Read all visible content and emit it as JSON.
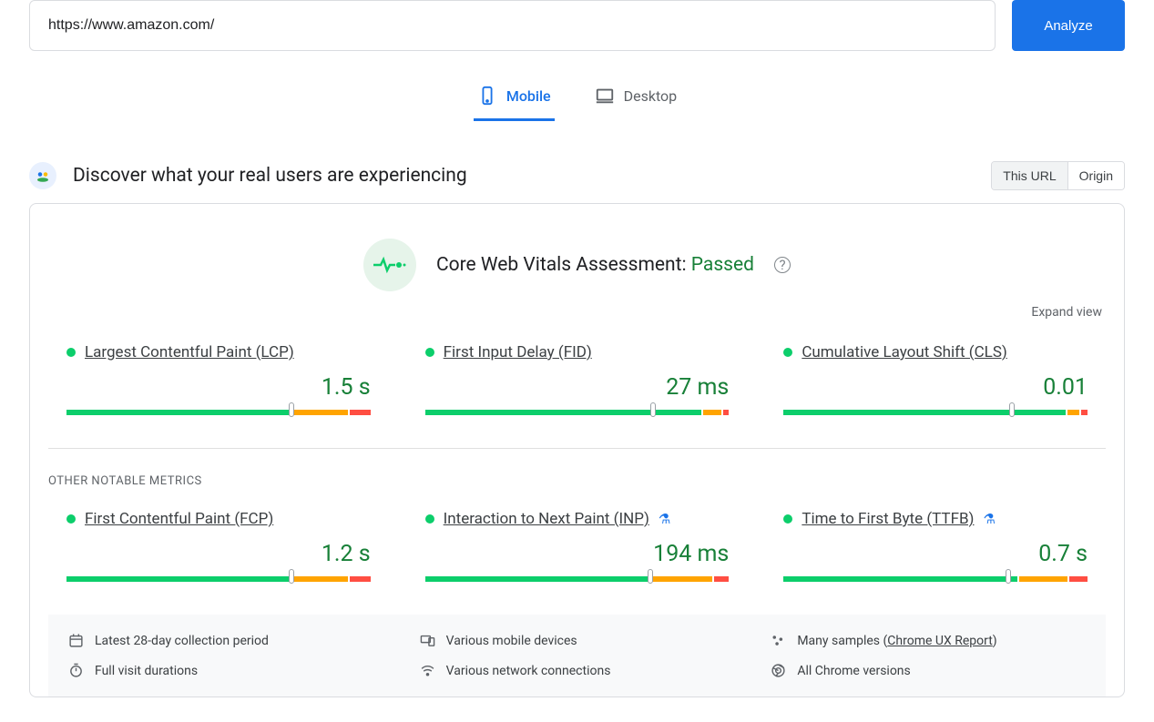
{
  "input": {
    "url": "https://www.amazon.com/",
    "button_label": "Analyze"
  },
  "tabs": {
    "mobile": "Mobile",
    "desktop": "Desktop",
    "active": "mobile"
  },
  "discover": {
    "title": "Discover what your real users are experiencing"
  },
  "scope_toggle": {
    "this_url": "This URL",
    "origin": "Origin",
    "active": "this_url"
  },
  "assessment": {
    "label": "Core Web Vitals Assessment: ",
    "status": "Passed"
  },
  "expand_label": "Expand view",
  "section_label": "OTHER NOTABLE METRICS",
  "metrics": {
    "lcp": {
      "name": "Largest Contentful Paint (LCP)",
      "value": "1.5 s",
      "status": "good",
      "experimental": false,
      "bar": {
        "green": 75,
        "orange": 18,
        "red": 7
      },
      "marker": 74
    },
    "fid": {
      "name": "First Input Delay (FID)",
      "value": "27 ms",
      "status": "good",
      "experimental": false,
      "bar": {
        "green": 92,
        "orange": 6,
        "red": 2
      },
      "marker": 75
    },
    "cls": {
      "name": "Cumulative Layout Shift (CLS)",
      "value": "0.01",
      "status": "good",
      "experimental": false,
      "bar": {
        "green": 94,
        "orange": 4,
        "red": 2
      },
      "marker": 75
    },
    "fcp": {
      "name": "First Contentful Paint (FCP)",
      "value": "1.2 s",
      "status": "good",
      "experimental": false,
      "bar": {
        "green": 75,
        "orange": 18,
        "red": 7
      },
      "marker": 74
    },
    "inp": {
      "name": "Interaction to Next Paint (INP)",
      "value": "194 ms",
      "status": "good",
      "experimental": true,
      "bar": {
        "green": 75,
        "orange": 20,
        "red": 5
      },
      "marker": 74
    },
    "ttfb": {
      "name": "Time to First Byte (TTFB)",
      "value": "0.7 s",
      "status": "good",
      "experimental": true,
      "bar": {
        "green": 78,
        "orange": 16,
        "red": 6
      },
      "marker": 74
    }
  },
  "footer": {
    "period": "Latest 28-day collection period",
    "devices": "Various mobile devices",
    "samples_prefix": "Many samples (",
    "samples_link": "Chrome UX Report",
    "samples_suffix": ")",
    "durations": "Full visit durations",
    "network": "Various network connections",
    "versions": "All Chrome versions"
  }
}
